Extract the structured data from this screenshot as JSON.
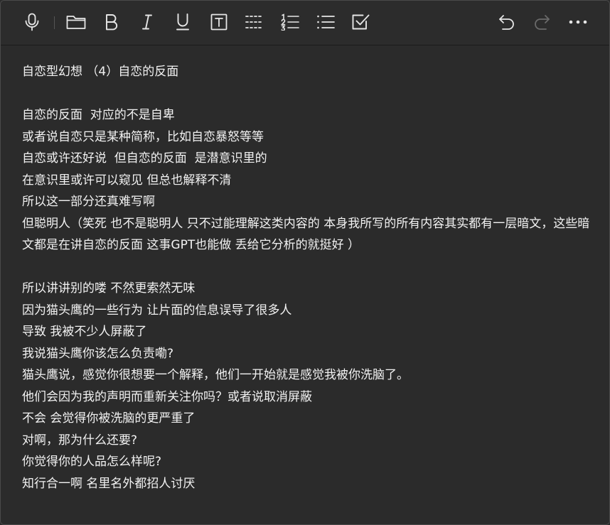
{
  "toolbar": {
    "icons": [
      "microphone-icon",
      "folder-icon",
      "bold-icon",
      "italic-icon",
      "underline-icon",
      "text-box-icon",
      "divider-icon",
      "numbered-list-icon",
      "bullet-list-icon",
      "checkbox-icon",
      "undo-icon",
      "redo-icon",
      "more-icon"
    ],
    "colors": {
      "icon": "#e6e6e6",
      "icon_disabled": "#6a6a6a"
    }
  },
  "editor": {
    "lines": [
      "自恋型幻想 （4）自恋的反面",
      "",
      "自恋的反面  对应的不是自卑",
      "或者说自恋只是某种简称，比如自恋暴怒等等",
      "自恋或许还好说  但自恋的反面  是潜意识里的",
      "在意识里或许可以窥见 但总也解释不清",
      "所以这一部分还真难写啊",
      "但聪明人（笑死 也不是聪明人 只不过能理解这类内容的 本身我所写的所有内容其实都有一层暗文，这些暗文都是在讲自恋的反面  这事GPT也能做 丢给它分析的就挺好 ）",
      "",
      "所以讲讲别的喽 不然更索然无味",
      "因为猫头鹰的一些行为 让片面的信息误导了很多人",
      "导致 我被不少人屏蔽了",
      "我说猫头鹰你该怎么负责嘞?",
      "猫头鹰说，感觉你很想要一个解释，他们一开始就是感觉我被你洗脑了。",
      "他们会因为我的声明而重新关注你吗？或者说取消屏蔽",
      "不会 会觉得你被洗脑的更严重了",
      "对啊，那为什么还要?",
      "你觉得你的人品怎么样呢?",
      "知行合一啊 名里名外都招人讨厌"
    ],
    "colors": {
      "background": "#2b2b2b",
      "text": "#f2f2f2"
    }
  }
}
